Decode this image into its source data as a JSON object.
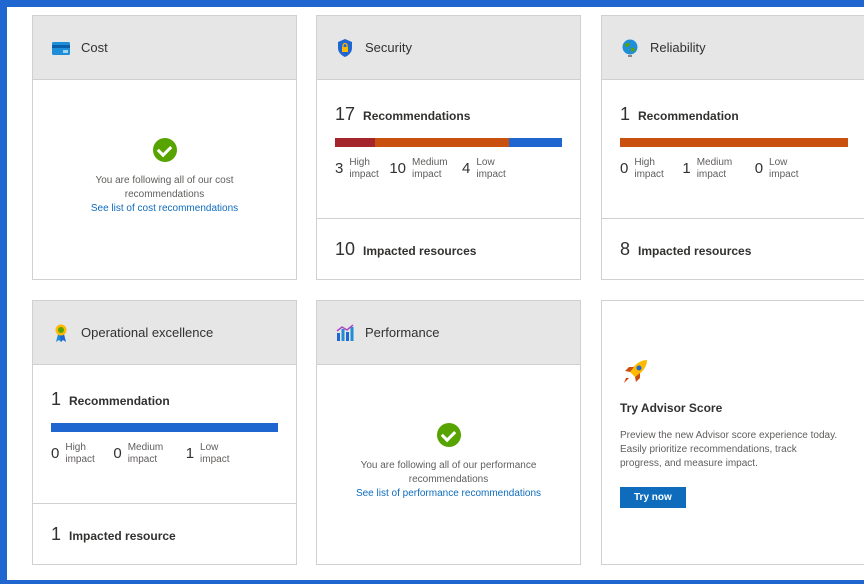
{
  "colors": {
    "high": "#a4262c",
    "medium": "#ca5010",
    "low": "#1f66d1",
    "ok": "#57a300",
    "accent": "#0f6cbd"
  },
  "cost": {
    "title": "Cost",
    "icon": "credit-card-icon",
    "message": "You are following all of our cost recommendations",
    "link": "See list of cost recommendations"
  },
  "security": {
    "title": "Security",
    "icon": "shield-icon",
    "count": "17",
    "count_label": "Recommendations",
    "bar": {
      "high": 3,
      "medium": 10,
      "low": 4
    },
    "high": "3",
    "medium": "10",
    "low": "4",
    "high_label": "High impact",
    "medium_label": "Medium impact",
    "low_label": "Low impact",
    "resources_count": "10",
    "resources_label": "Impacted resources"
  },
  "reliability": {
    "title": "Reliability",
    "icon": "globe-icon",
    "count": "1",
    "count_label": "Recommendation",
    "bar": {
      "high": 0,
      "medium": 1,
      "low": 0
    },
    "high": "0",
    "medium": "1",
    "low": "0",
    "high_label": "High impact",
    "medium_label": "Medium impact",
    "low_label": "Low impact",
    "resources_count": "8",
    "resources_label": "Impacted resources"
  },
  "operational": {
    "title": "Operational excellence",
    "icon": "ribbon-icon",
    "count": "1",
    "count_label": "Recommendation",
    "bar": {
      "high": 0,
      "medium": 0,
      "low": 1
    },
    "high": "0",
    "medium": "0",
    "low": "1",
    "high_label": "High impact",
    "medium_label": "Medium impact",
    "low_label": "Low impact",
    "resources_count": "1",
    "resources_label": "Impacted resource"
  },
  "performance": {
    "title": "Performance",
    "icon": "bar-chart-icon",
    "message": "You are following all of our performance recommendations",
    "link": "See list of performance recommendations"
  },
  "advisor": {
    "icon": "rocket-icon",
    "title": "Try Advisor Score",
    "description": "Preview the new Advisor score experience today. Easily prioritize recommendations, track progress, and measure impact.",
    "button": "Try now"
  }
}
